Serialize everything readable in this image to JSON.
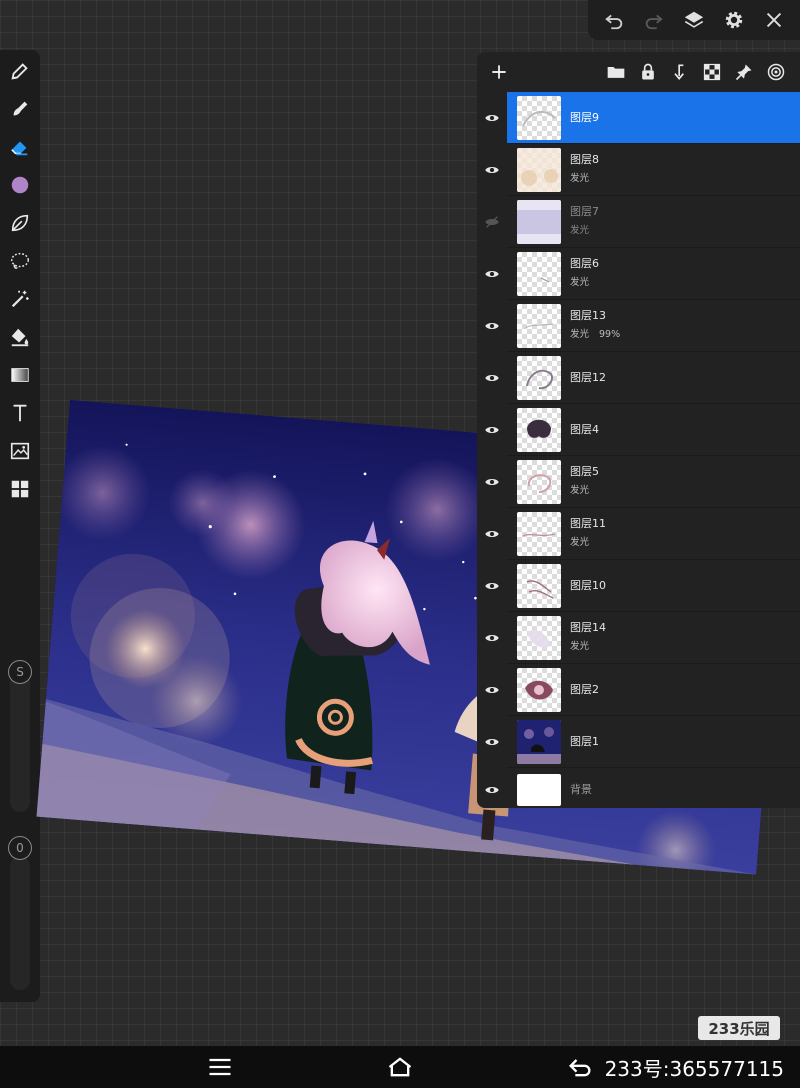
{
  "toolbar": {
    "icons": [
      "undo-icon",
      "redo-icon",
      "layers-icon",
      "settings-icon",
      "close-icon"
    ]
  },
  "tools": {
    "icons": [
      "pencil-icon",
      "smudge-icon",
      "eraser-icon",
      "color-icon",
      "leaf-brush-icon",
      "lasso-icon",
      "magic-wand-icon",
      "fill-bucket-icon",
      "gradient-icon",
      "text-icon",
      "image-icon",
      "grid-icon"
    ],
    "active_color": "#b084c8",
    "size_label": "S",
    "opacity_label": "0"
  },
  "layers_panel": {
    "header_icons": [
      "add-layer-icon",
      "folder-icon",
      "lock-icon",
      "merge-down-icon",
      "checker-icon",
      "pin-icon",
      "target-icon"
    ],
    "layers": [
      {
        "name": "图层9",
        "sub": "",
        "opacity": "",
        "visible": true,
        "selected": true
      },
      {
        "name": "图层8",
        "sub": "发光",
        "opacity": "",
        "visible": true,
        "selected": false
      },
      {
        "name": "图层7",
        "sub": "发光",
        "opacity": "",
        "visible": false,
        "selected": false
      },
      {
        "name": "图层6",
        "sub": "发光",
        "opacity": "",
        "visible": true,
        "selected": false
      },
      {
        "name": "图层13",
        "sub": "发光",
        "opacity": "99%",
        "visible": true,
        "selected": false
      },
      {
        "name": "图层12",
        "sub": "",
        "opacity": "",
        "visible": true,
        "selected": false
      },
      {
        "name": "图层4",
        "sub": "",
        "opacity": "",
        "visible": true,
        "selected": false
      },
      {
        "name": "图层5",
        "sub": "发光",
        "opacity": "",
        "visible": true,
        "selected": false
      },
      {
        "name": "图层11",
        "sub": "发光",
        "opacity": "",
        "visible": true,
        "selected": false
      },
      {
        "name": "图层10",
        "sub": "",
        "opacity": "",
        "visible": true,
        "selected": false
      },
      {
        "name": "图层14",
        "sub": "发光",
        "opacity": "",
        "visible": true,
        "selected": false
      },
      {
        "name": "图层2",
        "sub": "",
        "opacity": "",
        "visible": true,
        "selected": false
      },
      {
        "name": "图层1",
        "sub": "",
        "opacity": "",
        "visible": true,
        "selected": false
      }
    ],
    "background_layer": {
      "name": "背景",
      "visible": true
    }
  },
  "watermark": "233乐园",
  "navbar": {
    "id_text": "233号:365577115"
  },
  "colors": {
    "selected_layer": "#1a73e8",
    "panel_bg": "#222222",
    "canvas_bg": "#2b2b2b"
  }
}
